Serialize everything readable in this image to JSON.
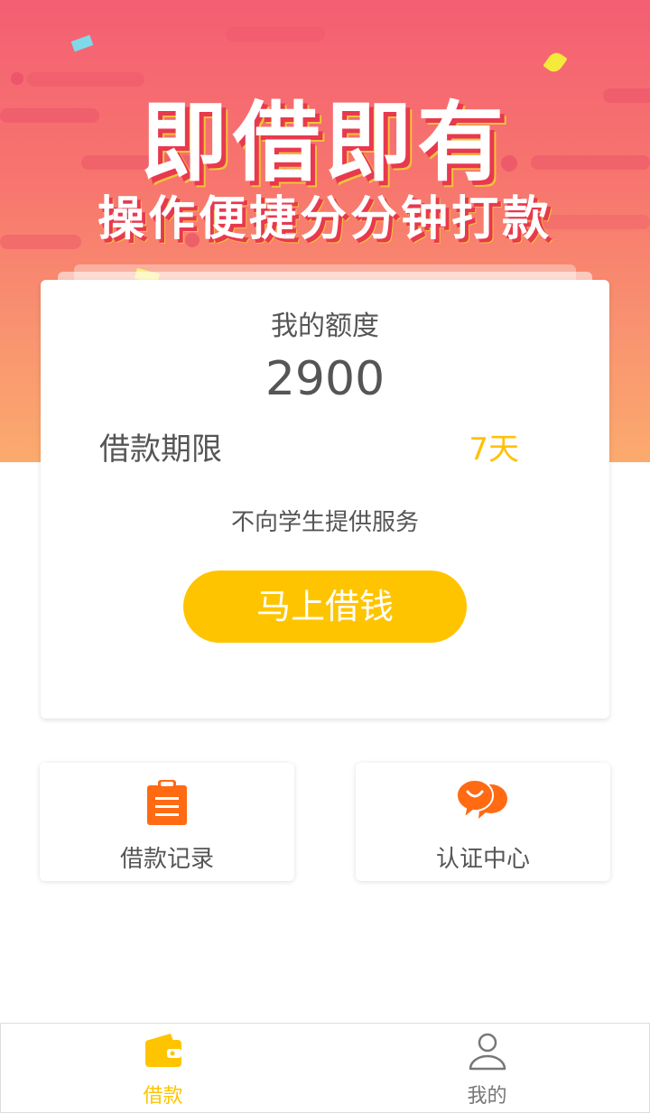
{
  "banner": {
    "headline": "即借即有",
    "subline": "操作便捷分分钟打款"
  },
  "quota_card": {
    "title": "我的额度",
    "amount": "2900",
    "term_label": "借款期限",
    "term_value": "7天",
    "notice": "不向学生提供服务",
    "borrow_button": "马上借钱"
  },
  "shortcuts": [
    {
      "label": "借款记录",
      "icon": "clipboard-icon"
    },
    {
      "label": "认证中心",
      "icon": "chat-bubbles-icon"
    }
  ],
  "tabbar": {
    "tabs": [
      {
        "label": "借款",
        "icon": "wallet-icon",
        "active": true
      },
      {
        "label": "我的",
        "icon": "user-icon",
        "active": false
      }
    ]
  },
  "colors": {
    "accent": "#ffc400",
    "icon_orange": "#ff6a13",
    "text_gray": "#555555",
    "banner_top": "#f45f73",
    "banner_bottom": "#fbaa6d"
  }
}
